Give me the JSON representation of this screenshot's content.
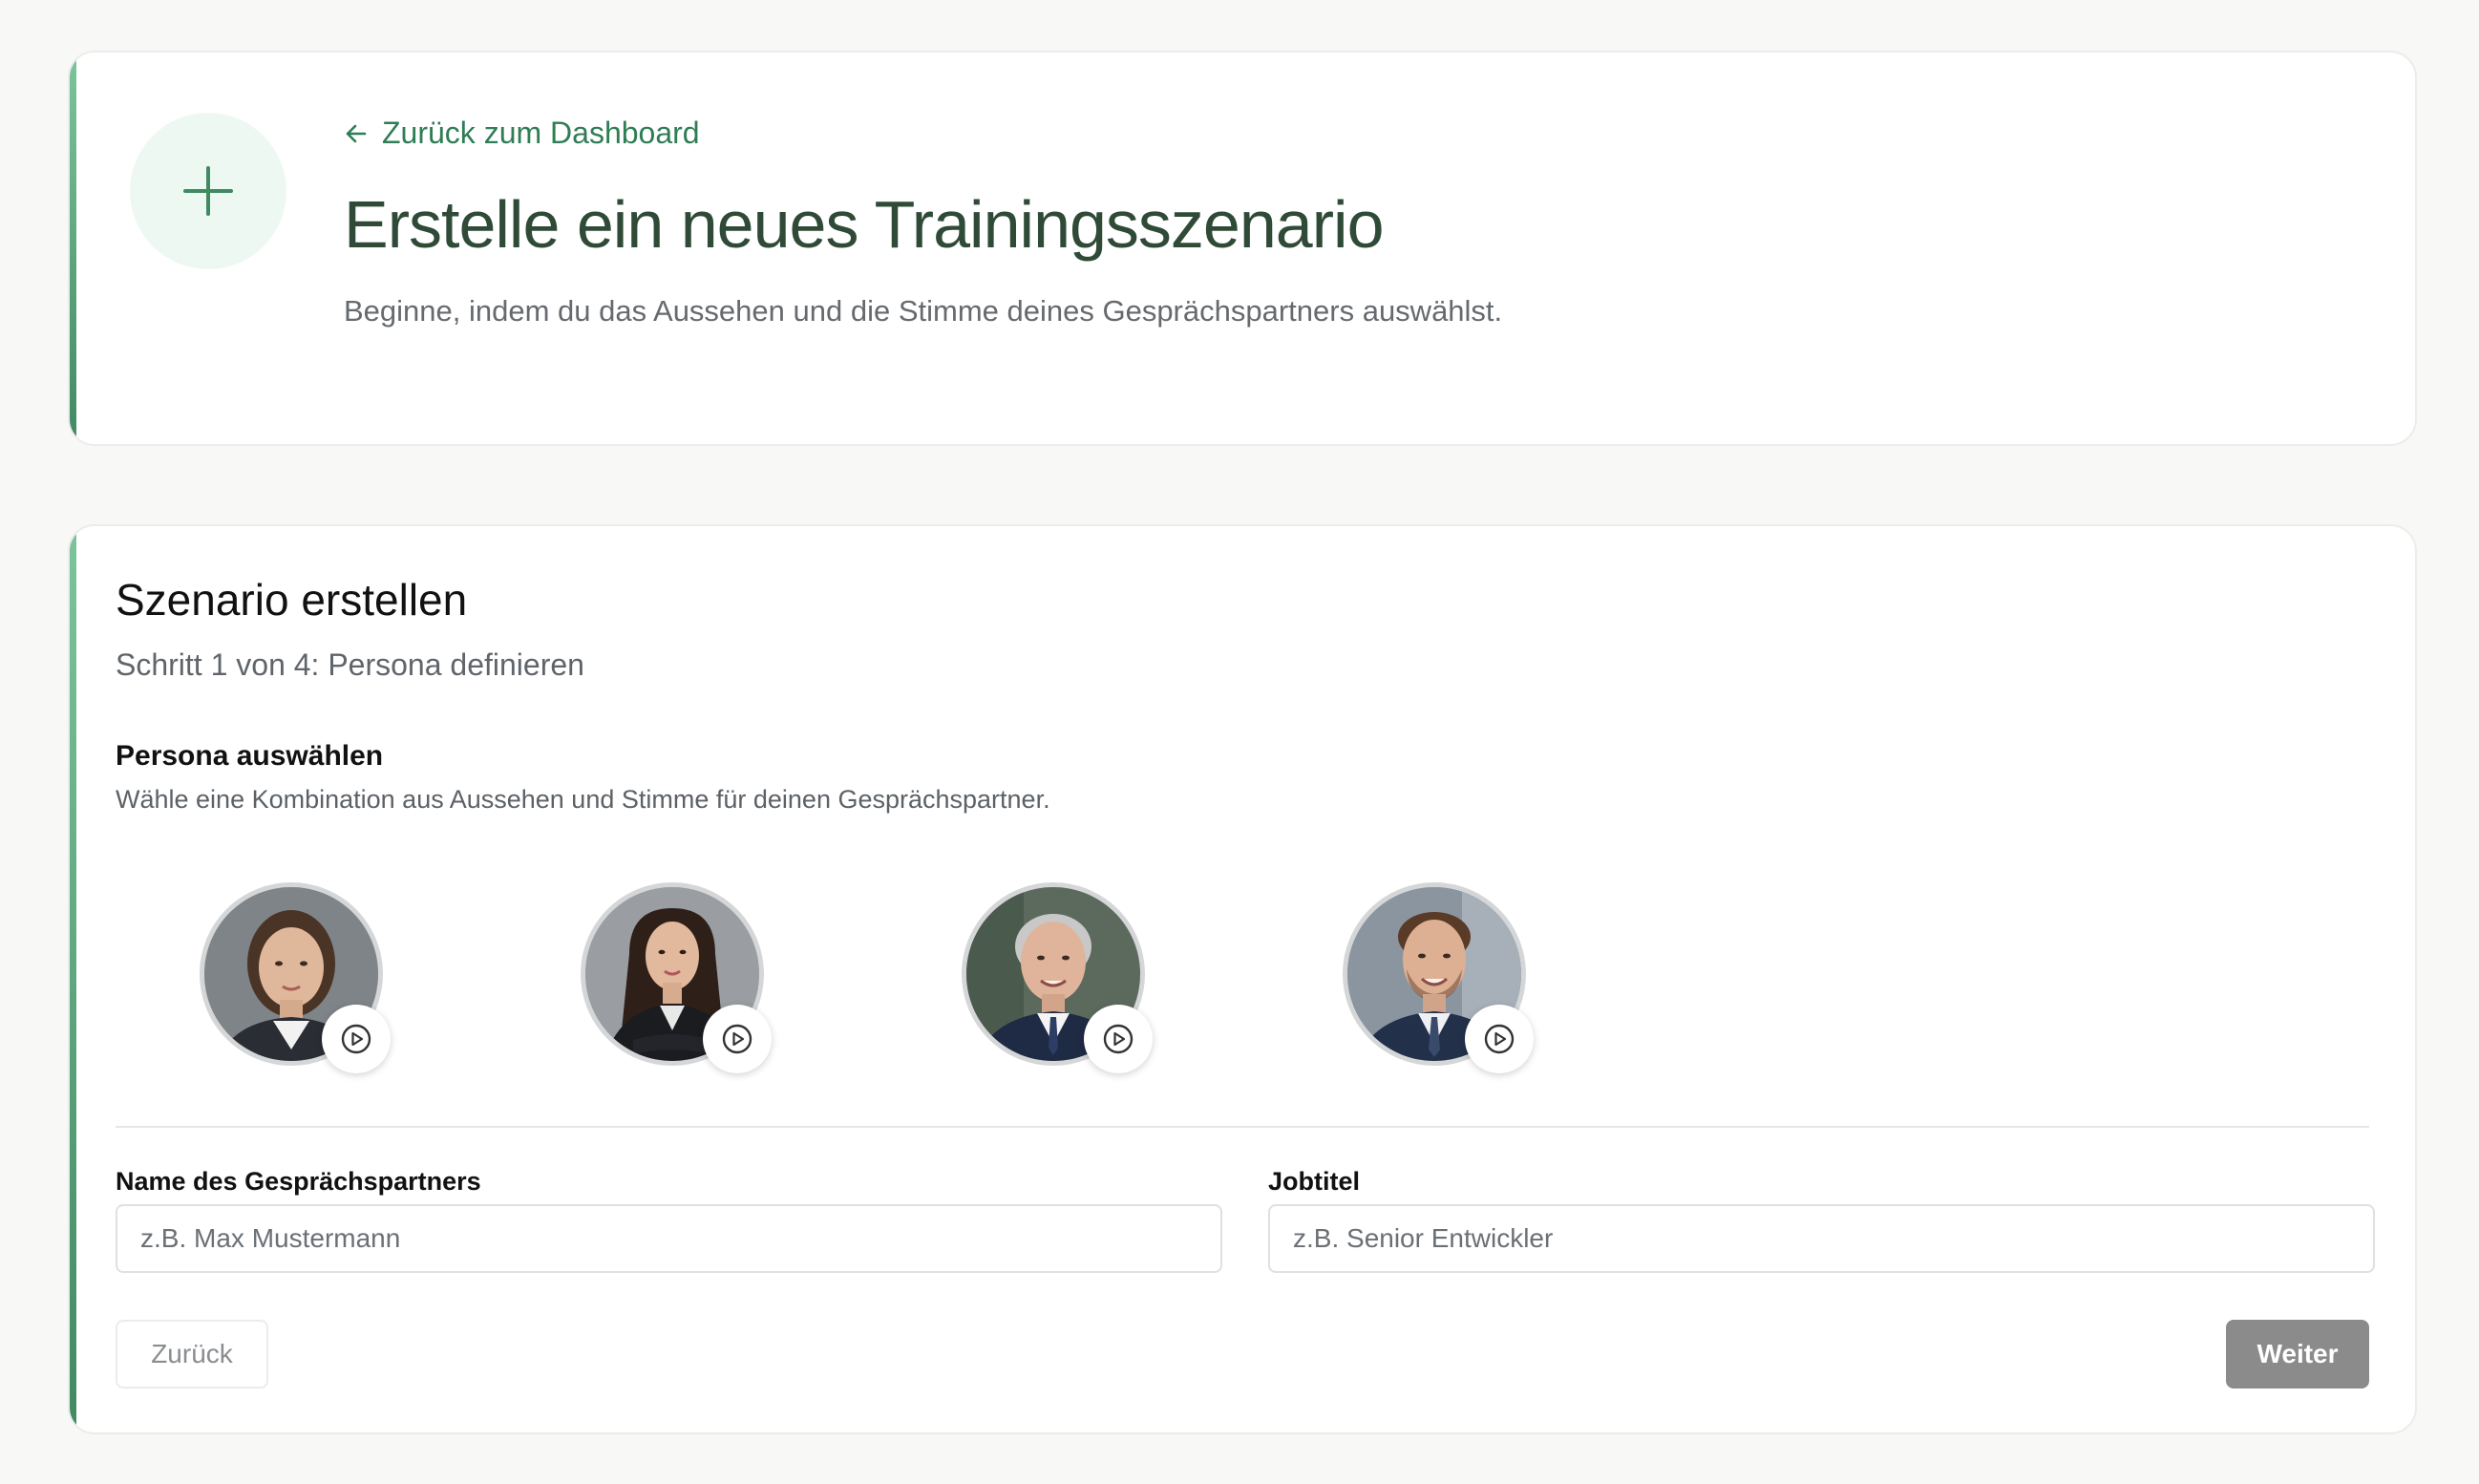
{
  "header": {
    "back_link": "Zurück zum Dashboard",
    "title": "Erstelle ein neues Trainingsszenario",
    "subtitle": "Beginne, indem du das Aussehen und die Stimme deines Gesprächspartners auswählst.",
    "icon": "plus-icon"
  },
  "wizard": {
    "title": "Szenario erstellen",
    "step": "Schritt 1 von 4: Persona definieren",
    "persona_heading": "Persona auswählen",
    "persona_description": "Wähle eine Kombination aus Aussehen und Stimme für deinen Gesprächspartner.",
    "personas": [
      {
        "id": "persona-1",
        "icon": "play-icon"
      },
      {
        "id": "persona-2",
        "icon": "play-icon"
      },
      {
        "id": "persona-3",
        "icon": "play-icon"
      },
      {
        "id": "persona-4",
        "icon": "play-icon"
      }
    ],
    "name_field": {
      "label": "Name des Gesprächspartners",
      "placeholder": "z.B. Max Mustermann",
      "value": ""
    },
    "job_field": {
      "label": "Jobtitel",
      "placeholder": "z.B. Senior Entwickler",
      "value": ""
    },
    "back_button": "Zurück",
    "next_button": "Weiter"
  },
  "colors": {
    "accent": "#2f7d55",
    "title": "#2f4a37",
    "disabled_button": "#8b8b8b"
  }
}
